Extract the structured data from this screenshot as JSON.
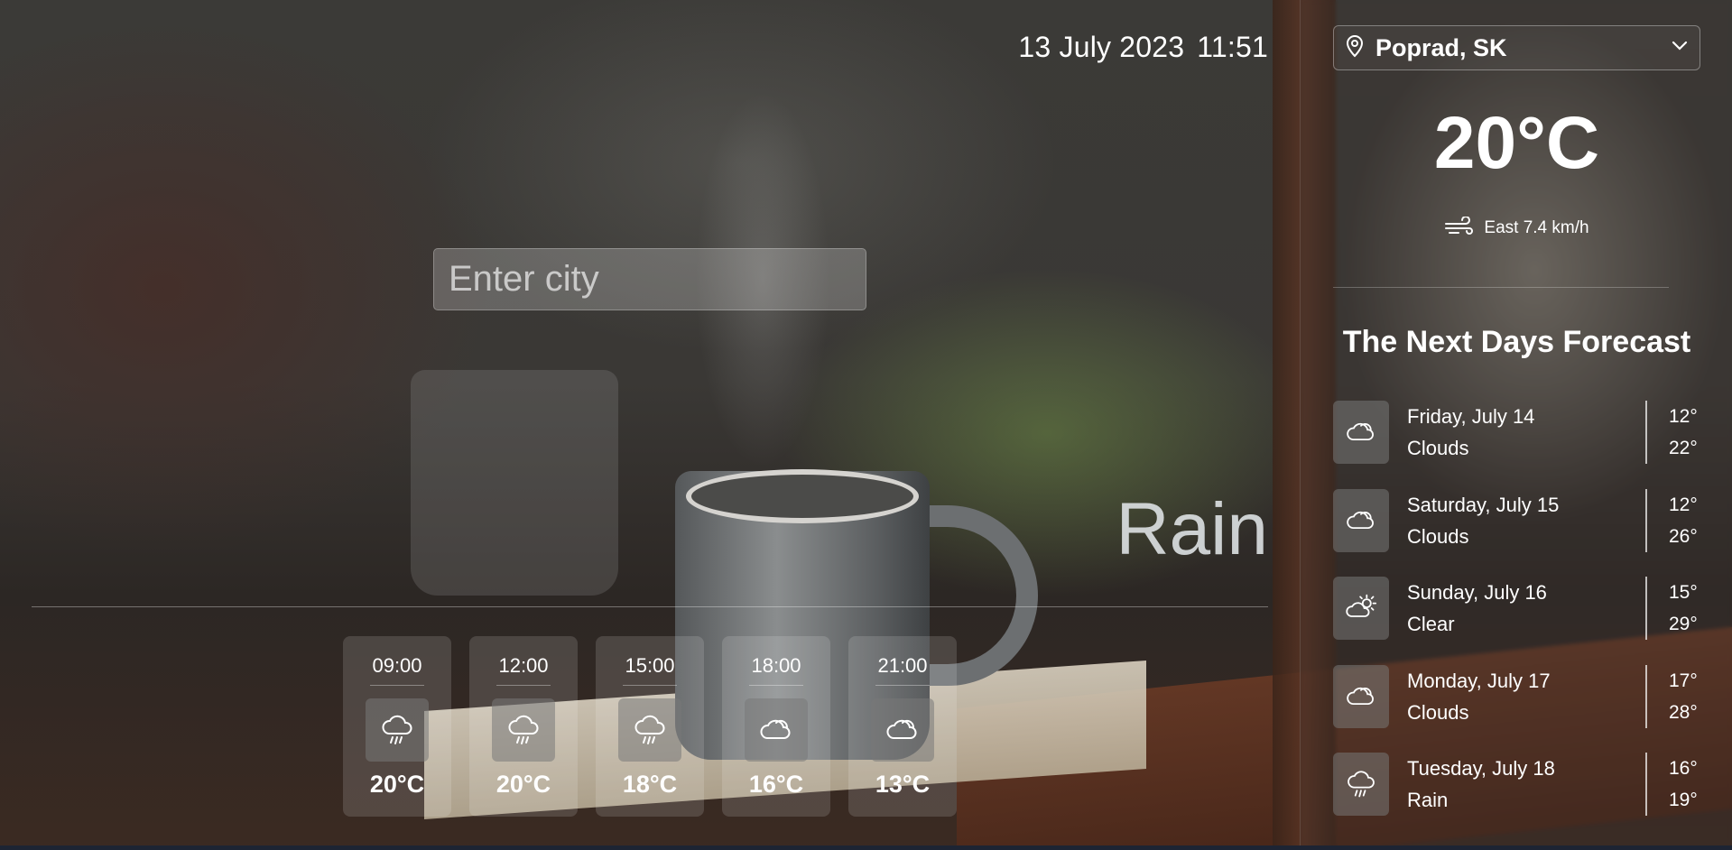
{
  "header": {
    "date": "13 July 2023",
    "time": "11:51"
  },
  "search": {
    "placeholder": "Enter city"
  },
  "current": {
    "condition": "Rain",
    "location": "Poprad, SK",
    "temperature": "20°C",
    "wind": "East 7.4 km/h"
  },
  "hourly": [
    {
      "time": "09:00",
      "temp": "20°C",
      "icon": "rain-icon"
    },
    {
      "time": "12:00",
      "temp": "20°C",
      "icon": "rain-icon"
    },
    {
      "time": "15:00",
      "temp": "18°C",
      "icon": "rain-icon"
    },
    {
      "time": "18:00",
      "temp": "16°C",
      "icon": "cloud-icon"
    },
    {
      "time": "21:00",
      "temp": "13°C",
      "icon": "cloud-icon"
    }
  ],
  "forecast": {
    "title": "The Next Days Forecast",
    "days": [
      {
        "date": "Friday, July 14",
        "condition": "Clouds",
        "low": "12°",
        "high": "22°",
        "icon": "cloud-icon"
      },
      {
        "date": "Saturday, July 15",
        "condition": "Clouds",
        "low": "12°",
        "high": "26°",
        "icon": "cloud-icon"
      },
      {
        "date": "Sunday, July 16",
        "condition": "Clear",
        "low": "15°",
        "high": "29°",
        "icon": "sun-cloud-icon"
      },
      {
        "date": "Monday, July 17",
        "condition": "Clouds",
        "low": "17°",
        "high": "28°",
        "icon": "cloud-icon"
      },
      {
        "date": "Tuesday, July 18",
        "condition": "Rain",
        "low": "16°",
        "high": "19°",
        "icon": "rain-icon"
      }
    ]
  },
  "colors": {
    "text": "#ffffff",
    "bottom_bar": "#1d2433"
  }
}
